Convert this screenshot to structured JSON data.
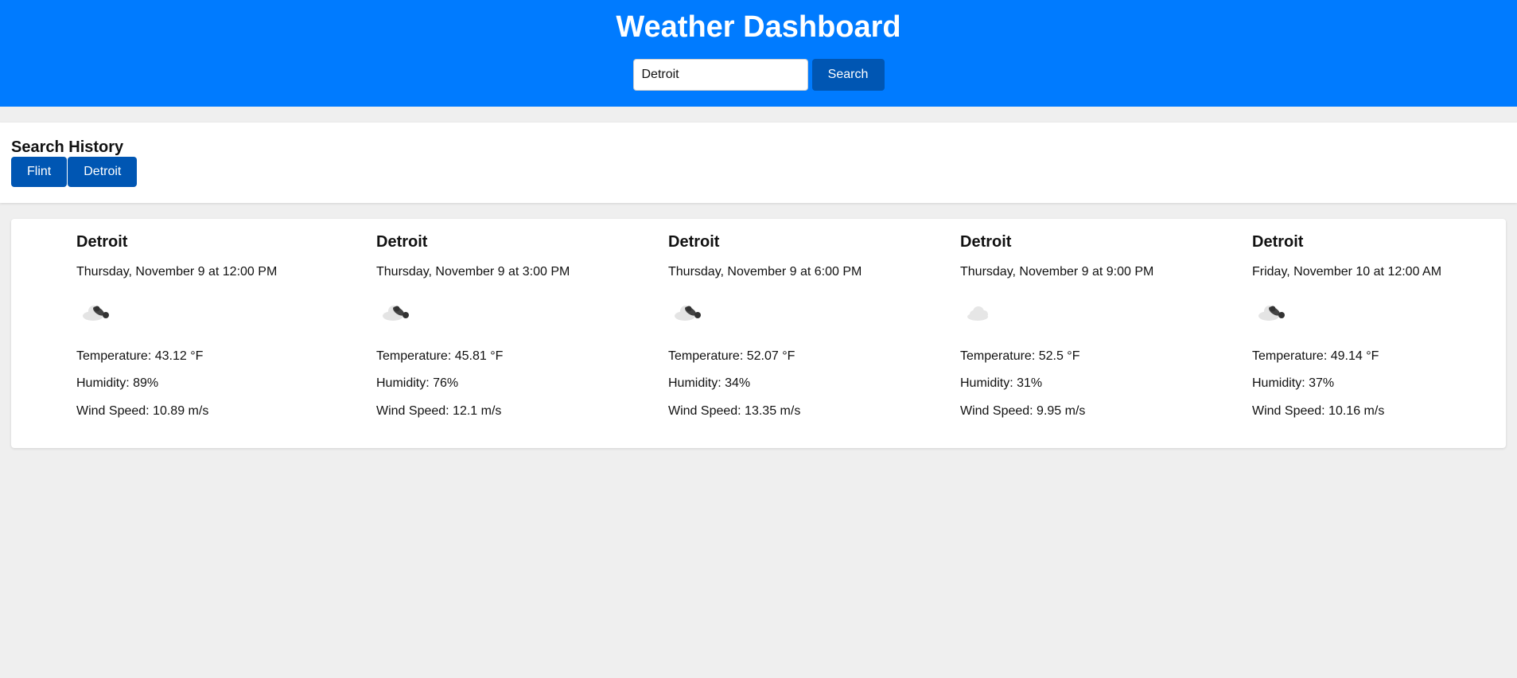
{
  "header": {
    "title": "Weather Dashboard",
    "search_value": "Detroit",
    "search_button": "Search"
  },
  "history": {
    "title": "Search History",
    "items": [
      "Flint",
      "Detroit"
    ]
  },
  "forecast": [
    {
      "city": "Detroit",
      "date": "Thursday, November 9 at 12:00 PM",
      "icon": "broken-clouds-icon",
      "temperature": "Temperature: 43.12 °F",
      "humidity": "Humidity: 89%",
      "wind": "Wind Speed: 10.89 m/s"
    },
    {
      "city": "Detroit",
      "date": "Thursday, November 9 at 3:00 PM",
      "icon": "broken-clouds-icon",
      "temperature": "Temperature: 45.81 °F",
      "humidity": "Humidity: 76%",
      "wind": "Wind Speed: 12.1 m/s"
    },
    {
      "city": "Detroit",
      "date": "Thursday, November 9 at 6:00 PM",
      "icon": "broken-clouds-icon",
      "temperature": "Temperature: 52.07 °F",
      "humidity": "Humidity: 34%",
      "wind": "Wind Speed: 13.35 m/s"
    },
    {
      "city": "Detroit",
      "date": "Thursday, November 9 at 9:00 PM",
      "icon": "few-clouds-icon",
      "temperature": "Temperature: 52.5 °F",
      "humidity": "Humidity: 31%",
      "wind": "Wind Speed: 9.95 m/s"
    },
    {
      "city": "Detroit",
      "date": "Friday, November 10 at 12:00 AM",
      "icon": "broken-clouds-icon",
      "temperature": "Temperature: 49.14 °F",
      "humidity": "Humidity: 37%",
      "wind": "Wind Speed: 10.16 m/s"
    }
  ],
  "colors": {
    "header_bg": "#007bff",
    "button_bg": "#0056b3",
    "page_bg": "#efefef"
  }
}
